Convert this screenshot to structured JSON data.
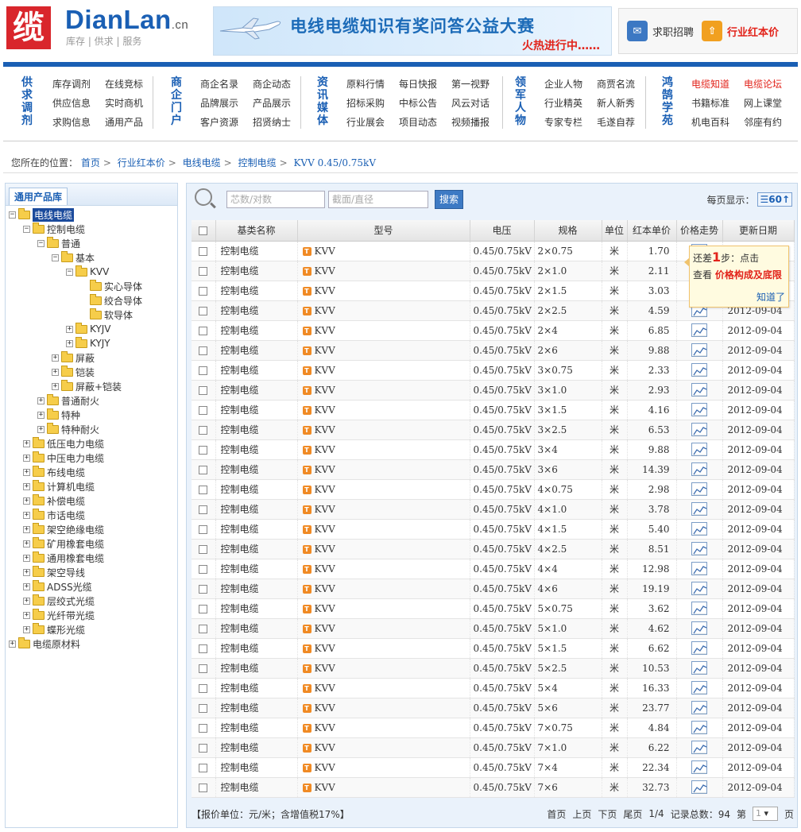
{
  "logo": {
    "glyph": "缆",
    "name": "DianLan",
    "tld": ".cn",
    "sub": "库存 | 供求 | 服务"
  },
  "banner": {
    "title": "电线电缆知识有奖问答公益大赛",
    "subtitle": "火热进行中……"
  },
  "top_links": [
    {
      "label": "求职招聘",
      "color": "#3c78c3"
    },
    {
      "label": "行业红本价",
      "color": "#e2231a"
    }
  ],
  "nav": [
    {
      "title": "供求调剂",
      "links": [
        "库存调剂",
        "在线竞标",
        "",
        "供应信息",
        "实时商机",
        "",
        "求购信息",
        "通用产品",
        ""
      ]
    },
    {
      "title": "商企门户",
      "links": [
        "商企名录",
        "商企动态",
        "",
        "品牌展示",
        "产品展示",
        "",
        "客户资源",
        "招贤纳士",
        ""
      ]
    },
    {
      "title": "资讯媒体",
      "links": [
        "原料行情",
        "每日快报",
        "第一视野",
        "招标采购",
        "中标公告",
        "风云对话",
        "行业展会",
        "项目动态",
        "视频播报"
      ]
    },
    {
      "title": "领军人物",
      "links": [
        "企业人物",
        "商贾名流",
        "",
        "行业精英",
        "新人新秀",
        "",
        "专家专栏",
        "毛遂自荐",
        ""
      ]
    },
    {
      "title": "鸿鹄学苑",
      "links": [
        "电缆知道",
        "电缆论坛",
        "",
        "书籍标准",
        "网上课堂",
        "",
        "机电百科",
        "邻座有约",
        ""
      ]
    }
  ],
  "breadcrumb": {
    "prefix": "您所在的位置：",
    "items": [
      "首页",
      "行业红本价",
      "电线电缆",
      "控制电缆",
      "KVV 0.45/0.75kV"
    ],
    "sep": ">"
  },
  "sidebar": {
    "tab": "通用产品库",
    "tree": [
      {
        "label": "电线电缆",
        "level": 0,
        "toggle": "-",
        "sel": true
      },
      {
        "label": "控制电缆",
        "level": 1,
        "toggle": "-"
      },
      {
        "label": "普通",
        "level": 2,
        "toggle": "-"
      },
      {
        "label": "基本",
        "level": 3,
        "toggle": "-"
      },
      {
        "label": "KVV",
        "level": 4,
        "toggle": "-"
      },
      {
        "label": "实心导体",
        "level": 5,
        "toggle": ""
      },
      {
        "label": "绞合导体",
        "level": 5,
        "toggle": ""
      },
      {
        "label": "软导体",
        "level": 5,
        "toggle": ""
      },
      {
        "label": "KYJV",
        "level": 4,
        "toggle": "+"
      },
      {
        "label": "KYJY",
        "level": 4,
        "toggle": "+"
      },
      {
        "label": "屏蔽",
        "level": 3,
        "toggle": "+"
      },
      {
        "label": "铠装",
        "level": 3,
        "toggle": "+"
      },
      {
        "label": "屏蔽+铠装",
        "level": 3,
        "toggle": "+"
      },
      {
        "label": "普通耐火",
        "level": 2,
        "toggle": "+"
      },
      {
        "label": "特种",
        "level": 2,
        "toggle": "+"
      },
      {
        "label": "特种耐火",
        "level": 2,
        "toggle": "+"
      },
      {
        "label": "低压电力电缆",
        "level": 1,
        "toggle": "+"
      },
      {
        "label": "中压电力电缆",
        "level": 1,
        "toggle": "+"
      },
      {
        "label": "布线电缆",
        "level": 1,
        "toggle": "+"
      },
      {
        "label": "计算机电缆",
        "level": 1,
        "toggle": "+"
      },
      {
        "label": "补偿电缆",
        "level": 1,
        "toggle": "+"
      },
      {
        "label": "市话电缆",
        "level": 1,
        "toggle": "+"
      },
      {
        "label": "架空绝缘电缆",
        "level": 1,
        "toggle": "+"
      },
      {
        "label": "矿用橡套电缆",
        "level": 1,
        "toggle": "+"
      },
      {
        "label": "通用橡套电缆",
        "level": 1,
        "toggle": "+"
      },
      {
        "label": "架空导线",
        "level": 1,
        "toggle": "+"
      },
      {
        "label": "ADSS光缆",
        "level": 1,
        "toggle": "+"
      },
      {
        "label": "层绞式光缆",
        "level": 1,
        "toggle": "+"
      },
      {
        "label": "光纤带光缆",
        "level": 1,
        "toggle": "+"
      },
      {
        "label": "蝶形光缆",
        "level": 1,
        "toggle": "+"
      },
      {
        "label": "电缆原材料",
        "level": 0,
        "toggle": "+"
      }
    ]
  },
  "search": {
    "core_placeholder": "芯数/对数",
    "section_placeholder": "截面/直径",
    "button": "搜索",
    "per_page_label": "每页显示：",
    "per_page": "60"
  },
  "table": {
    "headers": [
      "",
      "基类名称",
      "型号",
      "电压",
      "规格",
      "单位",
      "红本单价",
      "价格走势",
      "更新日期"
    ],
    "rows": [
      [
        "控制电缆",
        "KVV",
        "0.45/0.75kV",
        "2×0.75",
        "米",
        "1.70",
        ""
      ],
      [
        "控制电缆",
        "KVV",
        "0.45/0.75kV",
        "2×1.0",
        "米",
        "2.11",
        ""
      ],
      [
        "控制电缆",
        "KVV",
        "0.45/0.75kV",
        "2×1.5",
        "米",
        "3.03",
        ""
      ],
      [
        "控制电缆",
        "KVV",
        "0.45/0.75kV",
        "2×2.5",
        "米",
        "4.59",
        "2012-09-04"
      ],
      [
        "控制电缆",
        "KVV",
        "0.45/0.75kV",
        "2×4",
        "米",
        "6.85",
        "2012-09-04"
      ],
      [
        "控制电缆",
        "KVV",
        "0.45/0.75kV",
        "2×6",
        "米",
        "9.88",
        "2012-09-04"
      ],
      [
        "控制电缆",
        "KVV",
        "0.45/0.75kV",
        "3×0.75",
        "米",
        "2.33",
        "2012-09-04"
      ],
      [
        "控制电缆",
        "KVV",
        "0.45/0.75kV",
        "3×1.0",
        "米",
        "2.93",
        "2012-09-04"
      ],
      [
        "控制电缆",
        "KVV",
        "0.45/0.75kV",
        "3×1.5",
        "米",
        "4.16",
        "2012-09-04"
      ],
      [
        "控制电缆",
        "KVV",
        "0.45/0.75kV",
        "3×2.5",
        "米",
        "6.53",
        "2012-09-04"
      ],
      [
        "控制电缆",
        "KVV",
        "0.45/0.75kV",
        "3×4",
        "米",
        "9.88",
        "2012-09-04"
      ],
      [
        "控制电缆",
        "KVV",
        "0.45/0.75kV",
        "3×6",
        "米",
        "14.39",
        "2012-09-04"
      ],
      [
        "控制电缆",
        "KVV",
        "0.45/0.75kV",
        "4×0.75",
        "米",
        "2.98",
        "2012-09-04"
      ],
      [
        "控制电缆",
        "KVV",
        "0.45/0.75kV",
        "4×1.0",
        "米",
        "3.78",
        "2012-09-04"
      ],
      [
        "控制电缆",
        "KVV",
        "0.45/0.75kV",
        "4×1.5",
        "米",
        "5.40",
        "2012-09-04"
      ],
      [
        "控制电缆",
        "KVV",
        "0.45/0.75kV",
        "4×2.5",
        "米",
        "8.51",
        "2012-09-04"
      ],
      [
        "控制电缆",
        "KVV",
        "0.45/0.75kV",
        "4×4",
        "米",
        "12.98",
        "2012-09-04"
      ],
      [
        "控制电缆",
        "KVV",
        "0.45/0.75kV",
        "4×6",
        "米",
        "19.19",
        "2012-09-04"
      ],
      [
        "控制电缆",
        "KVV",
        "0.45/0.75kV",
        "5×0.75",
        "米",
        "3.62",
        "2012-09-04"
      ],
      [
        "控制电缆",
        "KVV",
        "0.45/0.75kV",
        "5×1.0",
        "米",
        "4.62",
        "2012-09-04"
      ],
      [
        "控制电缆",
        "KVV",
        "0.45/0.75kV",
        "5×1.5",
        "米",
        "6.62",
        "2012-09-04"
      ],
      [
        "控制电缆",
        "KVV",
        "0.45/0.75kV",
        "5×2.5",
        "米",
        "10.53",
        "2012-09-04"
      ],
      [
        "控制电缆",
        "KVV",
        "0.45/0.75kV",
        "5×4",
        "米",
        "16.33",
        "2012-09-04"
      ],
      [
        "控制电缆",
        "KVV",
        "0.45/0.75kV",
        "5×6",
        "米",
        "23.77",
        "2012-09-04"
      ],
      [
        "控制电缆",
        "KVV",
        "0.45/0.75kV",
        "7×0.75",
        "米",
        "4.84",
        "2012-09-04"
      ],
      [
        "控制电缆",
        "KVV",
        "0.45/0.75kV",
        "7×1.0",
        "米",
        "6.22",
        "2012-09-04"
      ],
      [
        "控制电缆",
        "KVV",
        "0.45/0.75kV",
        "7×4",
        "米",
        "22.34",
        "2012-09-04"
      ],
      [
        "控制电缆",
        "KVV",
        "0.45/0.75kV",
        "7×6",
        "米",
        "32.73",
        "2012-09-04"
      ]
    ]
  },
  "tooltip": {
    "line1a": "还差",
    "step": "1",
    "line1b": "步：点击",
    "line2a": "查看",
    "line2b": "价格构成及底限",
    "ok": "知道了"
  },
  "footer": {
    "note": "【报价单位：元/米；含增值税17%】",
    "first": "首页",
    "prev": "上页",
    "next": "下页",
    "last": "尾页",
    "pages": "1/4",
    "total_label": "记录总数：94",
    "goto_a": "第",
    "goto_val": "1",
    "goto_b": "页"
  },
  "colors": {
    "brand": "#1a5fb4",
    "accent_red": "#e2231a"
  }
}
